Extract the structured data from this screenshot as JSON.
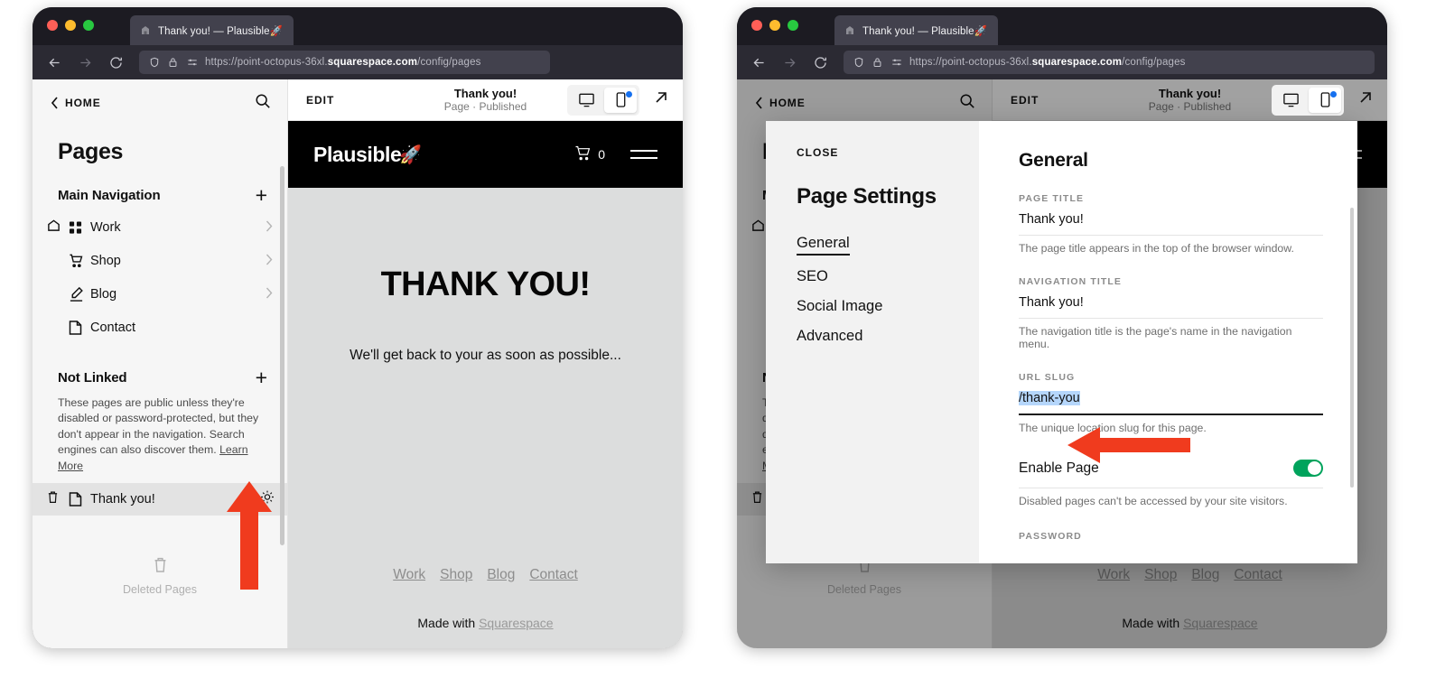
{
  "browser": {
    "tab_title": "Thank you! — Plausible🚀",
    "url_prefix": "https://point-octopus-36xl.",
    "url_domain": "squarespace.com",
    "url_path": "/config/pages",
    "back_icon": "back-arrow-icon",
    "forward_icon": "forward-arrow-icon",
    "reload_icon": "reload-icon"
  },
  "sidebar": {
    "home_label": "HOME",
    "search_icon": "search-icon",
    "title": "Pages",
    "main_nav": {
      "heading": "Main Navigation",
      "add_label": "+",
      "items": [
        {
          "label": "Work",
          "icon": "grid-icon",
          "has_chevron": true,
          "is_home": true
        },
        {
          "label": "Shop",
          "icon": "cart-icon",
          "has_chevron": true,
          "is_home": false
        },
        {
          "label": "Blog",
          "icon": "pen-icon",
          "has_chevron": true,
          "is_home": false
        },
        {
          "label": "Contact",
          "icon": "page-icon",
          "has_chevron": false,
          "is_home": false
        }
      ]
    },
    "not_linked": {
      "heading": "Not Linked",
      "add_label": "+",
      "description": "These pages are public unless they're disabled or password-protected, but they don't appear in the navigation. Search engines can also discover them. ",
      "learn_more": "Learn More",
      "items": [
        {
          "label": "Thank you!",
          "icon": "page-icon",
          "trash_icon": "trash-icon",
          "gear_icon": "gear-icon",
          "selected": true
        }
      ]
    },
    "deleted_pages": {
      "label": "Deleted Pages",
      "icon": "trash-icon"
    }
  },
  "preview": {
    "edit_label": "EDIT",
    "page_name": "Thank you!",
    "page_status": "Page · Published",
    "desktop_icon": "desktop-icon",
    "mobile_icon": "mobile-icon",
    "popout_icon": "external-link-icon",
    "site": {
      "brand": "Plausible",
      "brand_emoji": "🚀",
      "cart_count": "0",
      "cart_icon": "cart-icon",
      "menu_icon": "hamburger-icon",
      "heading": "THANK YOU!",
      "paragraph": "We'll get back to your as soon as possible...",
      "footer_links": [
        "Work",
        "Shop",
        "Blog",
        "Contact"
      ],
      "made_with_prefix": "Made with ",
      "made_with_brand": "Squarespace"
    }
  },
  "modal": {
    "close_label": "CLOSE",
    "title": "Page Settings",
    "nav": [
      {
        "label": "General",
        "active": true
      },
      {
        "label": "SEO",
        "active": false
      },
      {
        "label": "Social Image",
        "active": false
      },
      {
        "label": "Advanced",
        "active": false
      }
    ],
    "panel_title": "General",
    "fields": [
      {
        "label": "PAGE TITLE",
        "value": "Thank you!",
        "help": "The page title appears in the top of the browser window.",
        "focused": false,
        "selected": false
      },
      {
        "label": "NAVIGATION TITLE",
        "value": "Thank you!",
        "help": "The navigation title is the page's name in the navigation menu.",
        "focused": false,
        "selected": false
      },
      {
        "label": "URL SLUG",
        "value": "/thank-you",
        "help": "The unique location slug for this page.",
        "focused": true,
        "selected": true
      }
    ],
    "toggle": {
      "label": "Enable Page",
      "state": "on",
      "help": "Disabled pages can't be accessed by your site visitors."
    },
    "password_label": "PASSWORD"
  },
  "annotations": {
    "arrow_color": "#f03b1e",
    "left_arrow_target": "gear-icon on Thank you! row",
    "right_arrow_target": "URL slug field"
  },
  "colors": {
    "accent_green": "#00a35c",
    "selection_blue": "#b5d6fb",
    "notification_blue": "#1570ef",
    "chrome_bg": "#2b2a33",
    "site_bg": "#dcdddd"
  }
}
